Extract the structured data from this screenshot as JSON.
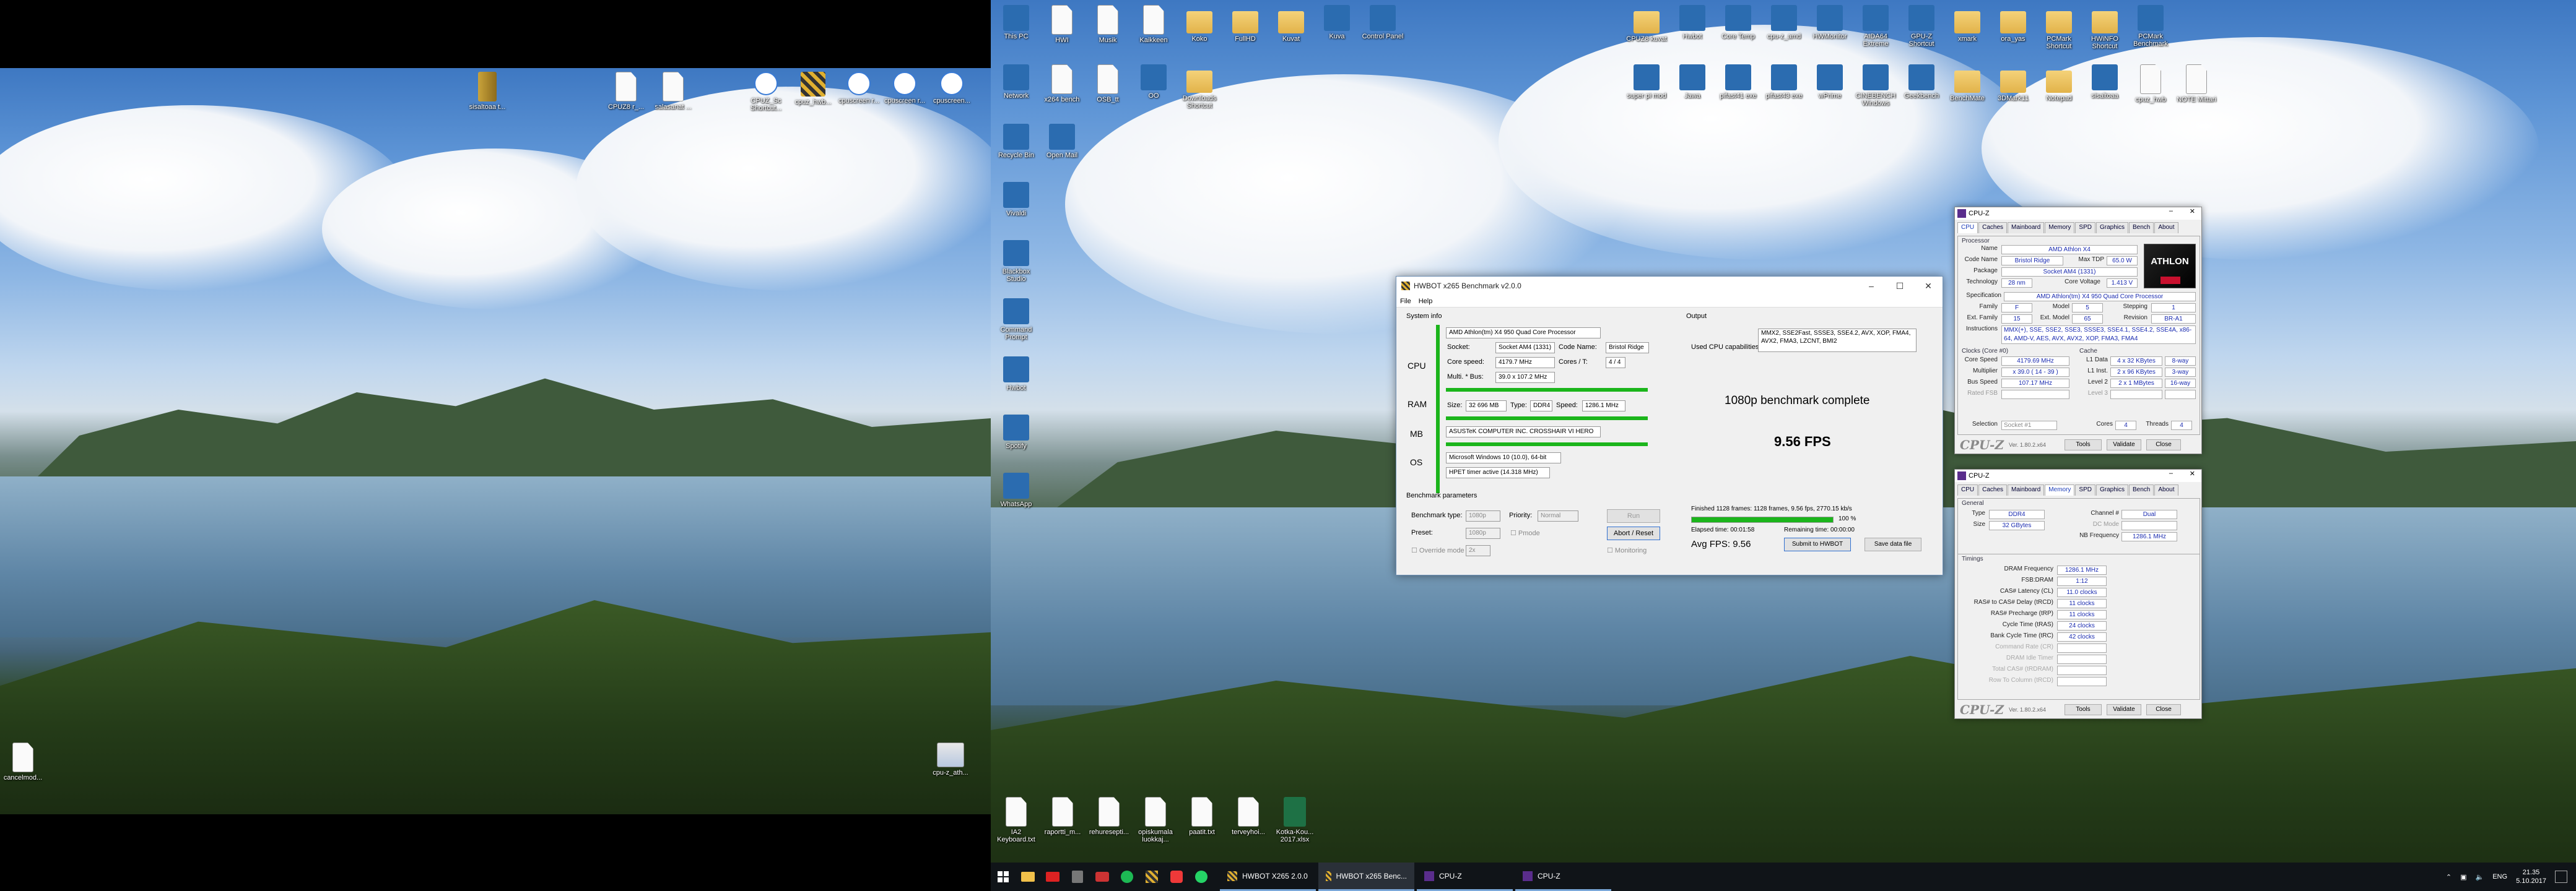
{
  "monitor1": {
    "icons": [
      {
        "label": "sisaltoaa t...",
        "kind": "archive"
      },
      {
        "label": "CPUZ8 r_...",
        "kind": "doc"
      },
      {
        "label": "salasanat ...",
        "kind": "doc"
      },
      {
        "label": "CPUZ_Sc Shortcut...",
        "kind": "app"
      },
      {
        "label": "cpuz_hwb...",
        "kind": "app"
      },
      {
        "label": "cpuscreen r...",
        "kind": "app"
      },
      {
        "label": "cpuscreen r...",
        "kind": "app"
      },
      {
        "label": "cpuscreen...",
        "kind": "app"
      },
      {
        "label": "cancelmod...",
        "kind": "doc"
      },
      {
        "label": "cpu-z_ath...",
        "kind": "image"
      }
    ]
  },
  "monitor2": {
    "left_icons": [
      {
        "label": "This PC",
        "kind": "app"
      },
      {
        "label": "HWI",
        "kind": "doc"
      },
      {
        "label": "Musik",
        "kind": "doc"
      },
      {
        "label": "Kaikkeen",
        "kind": "doc"
      },
      {
        "label": "Koko",
        "kind": "folder"
      },
      {
        "label": "FullHD",
        "kind": "folder"
      },
      {
        "label": "Kuvat",
        "kind": "folder"
      },
      {
        "label": "Kuva",
        "kind": "app"
      },
      {
        "label": "Control Panel",
        "kind": "app"
      },
      {
        "label": "Network",
        "kind": "app"
      },
      {
        "label": "x264 bench",
        "kind": "doc"
      },
      {
        "label": "OSB_tt",
        "kind": "doc"
      },
      {
        "label": "OO",
        "kind": "app"
      },
      {
        "label": "Downloads Shortcut",
        "kind": "folder"
      },
      {
        "label": "Recycle Bin",
        "kind": "app"
      },
      {
        "label": "Open Mail",
        "kind": "app"
      },
      {
        "label": "Vivaldi",
        "kind": "app"
      },
      {
        "label": "Blackbox Studio",
        "kind": "app"
      },
      {
        "label": "Command Prompt",
        "kind": "app"
      },
      {
        "label": "Hwbot",
        "kind": "app"
      },
      {
        "label": "Spotify",
        "kind": "app"
      },
      {
        "label": "WhatsApp",
        "kind": "app"
      }
    ],
    "top_right_icons": [
      {
        "label": "CPUZ8 kuvat",
        "kind": "folder"
      },
      {
        "label": "Hwbot",
        "kind": "app"
      },
      {
        "label": "Core Temp",
        "kind": "app"
      },
      {
        "label": "cpu-z_amd",
        "kind": "app"
      },
      {
        "label": "HWMonitor",
        "kind": "app"
      },
      {
        "label": "AIDA64 Extreme",
        "kind": "app"
      },
      {
        "label": "GPU-Z Shortcut",
        "kind": "app"
      },
      {
        "label": "xmark",
        "kind": "folder"
      },
      {
        "label": "ora_yas",
        "kind": "folder"
      },
      {
        "label": "PCMark Shortcut",
        "kind": "folder"
      },
      {
        "label": "HWiNFO Shortcut",
        "kind": "folder"
      },
      {
        "label": "PCMark Benchmark",
        "kind": "app"
      },
      {
        "label": "super pi mod",
        "kind": "app"
      },
      {
        "label": "Jawa",
        "kind": "app"
      },
      {
        "label": "pifast41 exe",
        "kind": "app"
      },
      {
        "label": "pifast43 exe",
        "kind": "app"
      },
      {
        "label": "wPrime",
        "kind": "app"
      },
      {
        "label": "CINEBENCH Windows",
        "kind": "app"
      },
      {
        "label": "Geekbench",
        "kind": "app"
      },
      {
        "label": "BenchMate",
        "kind": "folder"
      },
      {
        "label": "3DMark11",
        "kind": "folder"
      },
      {
        "label": "Notepad",
        "kind": "folder"
      },
      {
        "label": "sisaltoaa",
        "kind": "app"
      },
      {
        "label": "cpuz_hwb",
        "kind": "doc"
      },
      {
        "label": "NOTE Mittari",
        "kind": "doc"
      }
    ],
    "bottom_icons": [
      {
        "label": "IA2 Keyboard.txt",
        "kind": "doc"
      },
      {
        "label": "raportti_m...",
        "kind": "doc"
      },
      {
        "label": "rehuresepti...",
        "kind": "doc"
      },
      {
        "label": "opiskumala luokkaj...",
        "kind": "doc"
      },
      {
        "label": "paatit.txt",
        "kind": "doc"
      },
      {
        "label": "terveyhoi...",
        "kind": "doc"
      },
      {
        "label": "Kotka-Kou... 2017.xlsx",
        "kind": "excel"
      }
    ]
  },
  "hwbot": {
    "title": "HWBOT x265 Benchmark v2.0.0",
    "menu": [
      "File",
      "Help"
    ],
    "system_info_title": "System info",
    "output_title": "Output",
    "cpu_label": "CPU",
    "ram_label": "RAM",
    "mb_label": "MB",
    "os_label": "OS",
    "cpu_name": "AMD Athlon(tm) X4 950 Quad Core Processor",
    "socket_label": "Socket:",
    "socket_value": "Socket AM4 (1331)",
    "codename_label": "Code Name:",
    "codename_value": "Bristol Ridge",
    "corespeed_label": "Core speed:",
    "corespeed_value": "4179.7 MHz",
    "cores_label": "Cores / T:",
    "cores_value": "4 / 4",
    "mult_label": "Multi. * Bus:",
    "mult_value": "39.0 x 107.2 MHz",
    "ram_size_label": "Size:",
    "ram_size_value": "32 696 MB",
    "ram_type_label": "Type:",
    "ram_type_value": "DDR4",
    "ram_speed_label": "Speed:",
    "ram_speed_value": "1286.1 MHz",
    "mb_value": "ASUSTeK COMPUTER INC. CROSSHAIR VI HERO",
    "os_value": "Microsoft Windows 10 (10.0), 64-bit",
    "timer_value": "HPET timer active (14.318 MHz)",
    "capabilities_label": "Used CPU capabilities:",
    "capabilities_value": "MMX2, SSE2Fast, SSSE3, SSE4.2, AVX, XOP, FMA4, AVX2, FMA3, LZCNT, BMI2",
    "result_line": "1080p benchmark complete",
    "fps_big": "9.56 FPS",
    "params_title": "Benchmark parameters",
    "bench_type_label": "Benchmark type:",
    "bench_type_value": "1080p",
    "priority_label": "Priority:",
    "priority_value": "Normal",
    "run_label": "Run",
    "preset_label": "Preset:",
    "preset_value": "1080p",
    "pmode_label": "Pmode",
    "abort_label": "Abort / Reset",
    "override_label": "Override mode",
    "override_value": "2x",
    "monitoring_label": "Monitoring",
    "finished_line": "Finished 1128 frames: 1128 frames, 9.56 fps, 2770.15 kb/s",
    "progress_pct": 100,
    "progress_label": "100 %",
    "elapsed_label": "Elapsed time: 00:01:58",
    "remaining_label": "Remaining time: 00:00:00",
    "avg_fps": "Avg FPS: 9.56",
    "submit_label": "Submit to HWBOT",
    "save_label": "Save data file"
  },
  "cpuz1": {
    "title": "CPU-Z",
    "tabs": [
      "CPU",
      "Caches",
      "Mainboard",
      "Memory",
      "SPD",
      "Graphics",
      "Bench",
      "About"
    ],
    "active_tab": "CPU",
    "processor_title": "Processor",
    "name_k": "Name",
    "name_v": "AMD Athlon X4",
    "code_k": "Code Name",
    "code_v": "Bristol Ridge",
    "tdp_k": "Max TDP",
    "tdp_v": "65.0 W",
    "pkg_k": "Package",
    "pkg_v": "Socket AM4 (1331)",
    "tech_k": "Technology",
    "tech_v": "28 nm",
    "volt_k": "Core Voltage",
    "volt_v": "1.413 V",
    "spec_k": "Specification",
    "spec_v": "AMD Athlon(tm) X4 950 Quad Core Processor",
    "fam_k": "Family",
    "fam_v": "F",
    "model_k": "Model",
    "model_v": "5",
    "step_k": "Stepping",
    "step_v": "1",
    "efam_k": "Ext. Family",
    "efam_v": "15",
    "emod_k": "Ext. Model",
    "emod_v": "65",
    "rev_k": "Revision",
    "rev_v": "BR-A1",
    "instr_k": "Instructions",
    "instr_v": "MMX(+), SSE, SSE2, SSE3, SSSE3, SSE4.1, SSE4.2, SSE4A, x86-64, AMD-V, AES, AVX, AVX2, XOP, FMA3, FMA4",
    "clocks_title": "Clocks (Core #0)",
    "cache_title": "Cache",
    "cs_k": "Core Speed",
    "cs_v": "4179.69 MHz",
    "mu_k": "Multiplier",
    "mu_v": "x 39.0 ( 14 - 39 )",
    "bs_k": "Bus Speed",
    "bs_v": "107.17 MHz",
    "fsb_k": "Rated FSB",
    "l1d_k": "L1 Data",
    "l1d_v": "4 x 32 KBytes",
    "l1d_w": "8-way",
    "l1i_k": "L1 Inst.",
    "l1i_v": "2 x 96 KBytes",
    "l1i_w": "3-way",
    "l2_k": "Level 2",
    "l2_v": "2 x 1 MBytes",
    "l2_w": "16-way",
    "l3_k": "Level 3",
    "sel_k": "Selection",
    "sel_v": "Socket #1",
    "cores_k": "Cores",
    "cores_v": "4",
    "threads_k": "Threads",
    "threads_v": "4",
    "logo": "CPU-Z",
    "ver": "Ver. 1.80.2.x64",
    "tools": "Tools",
    "validate": "Validate",
    "close": "Close",
    "brand": "ATHLON"
  },
  "cpuz2": {
    "title": "CPU-Z",
    "tabs": [
      "CPU",
      "Caches",
      "Mainboard",
      "Memory",
      "SPD",
      "Graphics",
      "Bench",
      "About"
    ],
    "active_tab": "Memory",
    "general_title": "General",
    "type_k": "Type",
    "type_v": "DDR4",
    "chan_k": "Channel #",
    "chan_v": "Dual",
    "size_k": "Size",
    "size_v": "32 GBytes",
    "dc_k": "DC Mode",
    "nb_k": "NB Frequency",
    "nb_v": "1286.1 MHz",
    "timings_title": "Timings",
    "dram_k": "DRAM Frequency",
    "dram_v": "1286.1 MHz",
    "fsb_k": "FSB:DRAM",
    "fsb_v": "1:12",
    "cl_k": "CAS# Latency (CL)",
    "cl_v": "11.0 clocks",
    "rcd_k": "RAS# to CAS# Delay (tRCD)",
    "rcd_v": "11 clocks",
    "rp_k": "RAS# Precharge (tRP)",
    "rp_v": "11 clocks",
    "ras_k": "Cycle Time (tRAS)",
    "ras_v": "24 clocks",
    "rc_k": "Bank Cycle Time (tRC)",
    "rc_v": "42 clocks",
    "cr_k": "Command Rate (CR)",
    "idle_k": "DRAM Idle Timer",
    "tcas_k": "Total CAS# (tRDRAM)",
    "rtc_k": "Row To Column (tRCD)",
    "logo": "CPU-Z",
    "ver": "Ver. 1.80.2.x64",
    "tools": "Tools",
    "validate": "Validate",
    "close": "Close"
  },
  "taskbar": {
    "windows": [
      {
        "label": "HWBOT X265 2.0.0",
        "active": false
      },
      {
        "label": "HWBOT x265 Benc...",
        "active": true
      },
      {
        "label": "CPU-Z",
        "active": false
      },
      {
        "label": "CPU-Z",
        "active": false
      }
    ],
    "lang": "ENG",
    "time": "21.35",
    "date": "5.10.2017"
  },
  "colors": {
    "accent": "#1bb51b",
    "title_blue": "#1a3bb8",
    "taskbar": "#101418"
  }
}
